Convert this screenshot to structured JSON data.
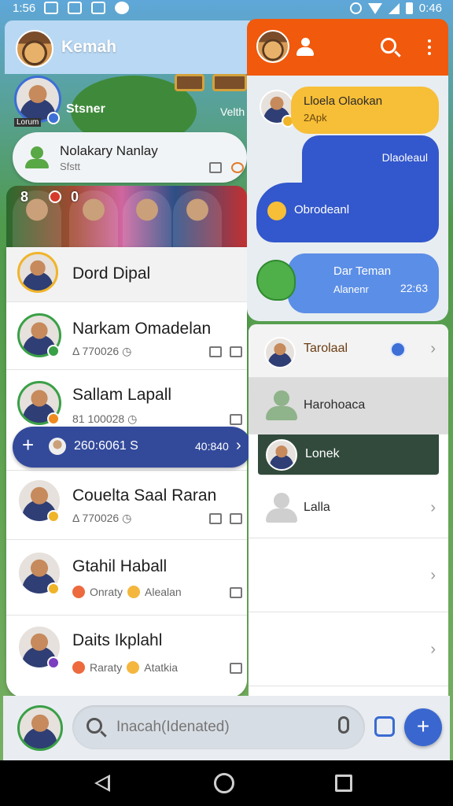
{
  "status_bar": {
    "time": "1:56",
    "clock": "0:46"
  },
  "app": {
    "title": "Kemah"
  },
  "story": {
    "user_name": "Stsner",
    "user_tag": "Lorum",
    "right_tag": "Velth"
  },
  "note": {
    "name": "Nolakary Nanlay",
    "sub": "Sfstt"
  },
  "stories_strip": {
    "count_a": "8",
    "count_b": "0"
  },
  "chats": [
    {
      "name": "Dord Dipal",
      "sub": ""
    },
    {
      "name": "Narkam Omadelan",
      "sub": "Δ 770026 ◷"
    },
    {
      "name": "Sallam Lapall",
      "sub": "81 100028 ◷"
    },
    {
      "name": "Couelta Saal Raran",
      "sub": "Δ 770026 ◷"
    },
    {
      "name": "Gtahil Haball",
      "sub_a": "Onraty",
      "sub_b": "Alealan"
    },
    {
      "name": "Daits Ikplahl",
      "sub_a": "Raraty",
      "sub_b": "Atatkia"
    }
  ],
  "banner": {
    "plus": "+",
    "text": "260:6061 S",
    "value": "40:840",
    "chevron": "›"
  },
  "search": {
    "placeholder": "Inacah(Idenated)"
  },
  "fab": {
    "label": "+"
  },
  "right_chat": {
    "bubble1_name": "Lloela Olaokan",
    "bubble1_time": "2Apk",
    "bubble2_text": "Dlaoleaul",
    "bubble2_msg": "Obrodeanl",
    "bubble3_name": "Dar Teman",
    "bubble3_sub": "Alanenr",
    "bubble3_time": "22:63"
  },
  "right_list": [
    {
      "name": "Tarolaal"
    },
    {
      "name": "Harohoaca"
    },
    {
      "name": "Lonek"
    },
    {
      "name": "Lalla"
    },
    {
      "name": ""
    },
    {
      "name": ""
    }
  ],
  "colors": {
    "accent_orange": "#f1590c",
    "accent_blue": "#3357cc",
    "yellow": "#f7be37",
    "green_bg": "#4f9a4b"
  }
}
